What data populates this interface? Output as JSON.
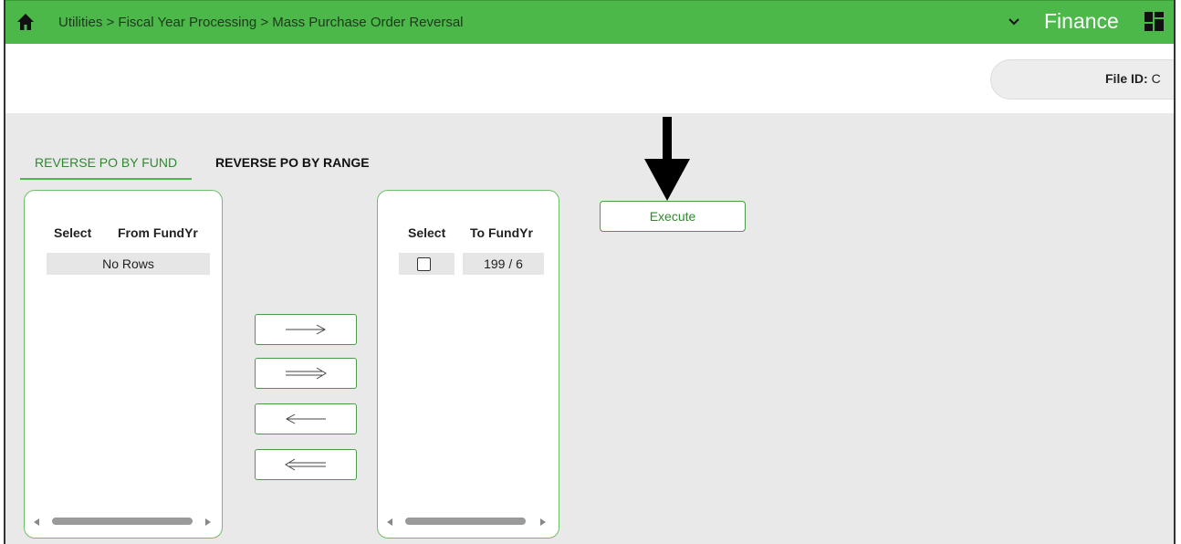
{
  "header": {
    "breadcrumb": "Utilities > Fiscal Year Processing > Mass Purchase Order Reversal",
    "app_name": "Finance",
    "bar_color": "#4cb84a",
    "icons": [
      "home-icon",
      "chevron-down-icon",
      "app-grid-icon"
    ]
  },
  "file_info": {
    "label": "File ID:",
    "value": "C"
  },
  "tabs": [
    {
      "label": "REVERSE PO BY FUND",
      "active": true
    },
    {
      "label": "REVERSE PO BY RANGE",
      "active": false
    }
  ],
  "left_table": {
    "columns": [
      "Select",
      "From FundYr"
    ],
    "empty_text": "No Rows"
  },
  "right_table": {
    "columns": [
      "Select",
      "To FundYr"
    ],
    "rows": [
      {
        "selected": false,
        "fund_yr": "199 / 6"
      }
    ]
  },
  "move_buttons": [
    {
      "name": "move-selected-right",
      "icon": "arrow-right-icon"
    },
    {
      "name": "move-all-right",
      "icon": "double-arrow-right-icon"
    },
    {
      "name": "move-selected-left",
      "icon": "arrow-left-icon"
    },
    {
      "name": "move-all-left",
      "icon": "double-arrow-left-icon"
    }
  ],
  "actions": {
    "execute_label": "Execute"
  },
  "accent_color": "#2f8a2f"
}
